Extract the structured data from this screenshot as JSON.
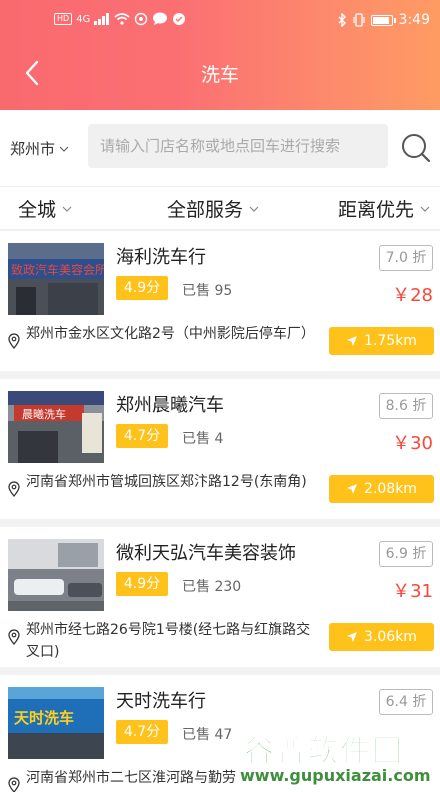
{
  "statusbar": {
    "left_chip": "HD",
    "network": "4G",
    "time": "3:49"
  },
  "nav": {
    "title": "洗车"
  },
  "search": {
    "city": "郑州市",
    "placeholder": "请输入门店名称或地点回车进行搜索"
  },
  "filters": {
    "area": "全城",
    "service": "全部服务",
    "sort": "距离优先"
  },
  "shops": [
    {
      "name": "海利洗车行",
      "score": "4.9分",
      "sold": "已售 95",
      "discount": "7.0 折",
      "price": "￥28",
      "address": "郑州市金水区文化路2号（中州影院后停车厂）",
      "distance": "1.75km",
      "thumb_sign": "致政汽车美容会所"
    },
    {
      "name": "郑州晨曦汽车",
      "score": "4.7分",
      "sold": "已售 4",
      "discount": "8.6 折",
      "price": "￥30",
      "address": "河南省郑州市管城回族区郑汴路12号(东南角)",
      "distance": "2.08km",
      "thumb_sign": "晨曦洗车"
    },
    {
      "name": "微利天弘汽车美容装饰",
      "score": "4.9分",
      "sold": "已售 230",
      "discount": "6.9 折",
      "price": "￥31",
      "address": "郑州市经七路26号院1号楼(经七路与红旗路交叉口)",
      "distance": "3.06km",
      "thumb_sign": ""
    },
    {
      "name": "天时洗车行",
      "score": "4.7分",
      "sold": "已售 47",
      "discount": "6.4 折",
      "price": "",
      "address": "河南省郑州市二七区淮河路与勤劳",
      "distance": "",
      "thumb_sign": "天时洗车"
    }
  ],
  "watermark": {
    "title": "谷普软件园",
    "url": "www.gupuxiazai.com"
  },
  "colors": {
    "header_start": "#f96a6f",
    "header_end": "#fe9b63",
    "accent_yellow": "#ffc21a",
    "price_red": "#f5493a"
  }
}
